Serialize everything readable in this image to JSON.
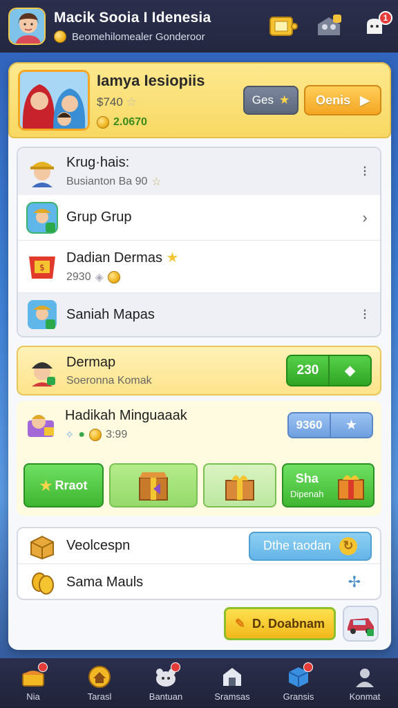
{
  "header": {
    "title": "Macik Sooia I Idenesia",
    "subtitle": "Beomehilomealer Gonderoor",
    "notif_count": "1"
  },
  "profile": {
    "name": "Iamya Iesiopiis",
    "score": "$740",
    "coins": "2.0670",
    "btn_gray_label": "Ges",
    "btn_gold_label": "Oenis"
  },
  "list": [
    {
      "title": "Krug·hais:",
      "sub": "Busianton Ba 90"
    },
    {
      "title": "Grup Grup",
      "sub": ""
    },
    {
      "title": "Dadian Dermas",
      "sub": "2930"
    },
    {
      "title": "Saniah Mapas",
      "sub": ""
    }
  ],
  "mission": {
    "title": "Dermap",
    "sub": "Soeronna Komak",
    "btn_label": "230"
  },
  "gift": {
    "title": "Hadikah Minguaaak",
    "sub": "3:99",
    "btn_label": "9360",
    "tile1_label": "Rraot",
    "tile4_title": "Sha",
    "tile4_sub": "Dipenah"
  },
  "bottom_list": [
    {
      "title": "Veolcespn",
      "btn_label": "Dthe taodan"
    },
    {
      "title": "Sama Mauls"
    }
  ],
  "bottom_button": {
    "label": "D. Doabnam"
  },
  "nav": [
    {
      "label": "Nia"
    },
    {
      "label": "Tarasl"
    },
    {
      "label": "Bantuan"
    },
    {
      "label": "Sramsas"
    },
    {
      "label": "Gransis"
    },
    {
      "label": "Konmat"
    }
  ],
  "colors": {
    "accent_gold": "#f4a623",
    "accent_green": "#2fa524",
    "header_bg": "#2b2f4d"
  }
}
